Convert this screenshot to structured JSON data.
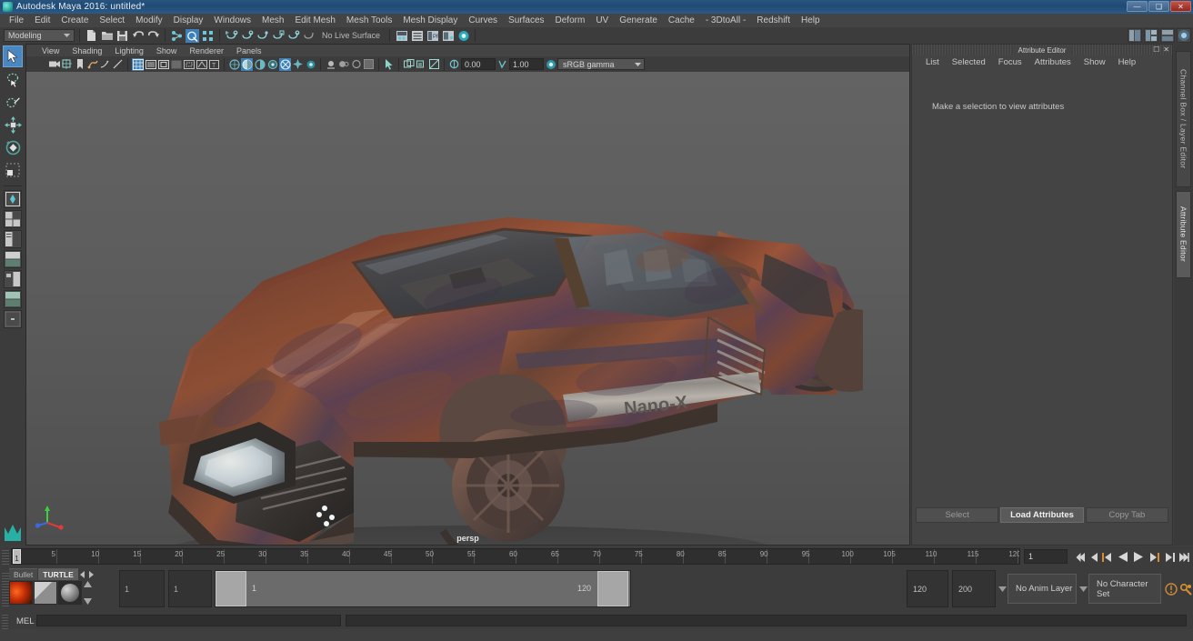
{
  "window": {
    "title": "Autodesk Maya 2016: untitled*",
    "controls": [
      "minimize",
      "restore",
      "close"
    ]
  },
  "menubar": {
    "items": [
      "File",
      "Edit",
      "Create",
      "Select",
      "Modify",
      "Display",
      "Windows",
      "Mesh",
      "Edit Mesh",
      "Mesh Tools",
      "Mesh Display",
      "Curves",
      "Surfaces",
      "Deform",
      "UV",
      "Generate",
      "Cache",
      "- 3DtoAll -",
      "Redshift",
      "Help"
    ]
  },
  "statusbar": {
    "menuset": "Modeling",
    "live_surface": "No Live Surface",
    "icons": [
      "new-scene-icon",
      "open-scene-icon",
      "save-scene-icon",
      "undo-icon",
      "redo-icon",
      "select-by-hierarchy-icon",
      "select-by-object-icon",
      "select-by-component-icon",
      "snap-to-grid-icon",
      "snap-to-curve-icon",
      "snap-to-point-icon",
      "snap-to-projected-center-icon",
      "snap-to-view-planes-icon",
      "make-live-icon",
      "show-hide-editors-icon",
      "attribute-editor-icon",
      "tool-settings-icon",
      "channel-box-icon",
      "render-view-icon"
    ]
  },
  "toolbox": {
    "tools": [
      "select-tool",
      "lasso-select-tool",
      "paint-select-tool",
      "move-tool",
      "rotate-tool",
      "scale-tool",
      "last-tool"
    ],
    "selected": "select-tool",
    "layouts": [
      "single-perspective-layout",
      "four-view-layout",
      "two-panes-side-layout",
      "outliner-persp-layout",
      "hypershade-persp-layout",
      "persp-graph-layout",
      "two-panes-stacked-layout"
    ]
  },
  "viewport": {
    "menus": [
      "View",
      "Shading",
      "Lighting",
      "Show",
      "Renderer",
      "Panels"
    ],
    "camera_label": "persp",
    "exposure": "0.00",
    "gamma": "1.00",
    "color_management": "sRGB gamma",
    "model_decal": "Nano-X",
    "icons": [
      "camera-icon",
      "two-d-pan-zoom-icon",
      "bookmark-icon",
      "image-plane-icon",
      "grid-icon",
      "film-gate-icon",
      "resolution-gate-icon",
      "gate-mask-icon",
      "film-origin-icon",
      "xray-icon",
      "xray-joints-icon",
      "xray-active-components-icon",
      "wireframe-icon",
      "smooth-shade-icon",
      "shaded-textured-icon",
      "use-all-lights-icon",
      "shadows-icon",
      "ambient-occlusion-icon",
      "motion-blur-icon",
      "multisample-icon",
      "depth-of-field-icon",
      "isolate-select-icon",
      "viewport-snapshot-icon",
      "exposure-icon",
      "gamma-icon",
      "color-management-icon"
    ]
  },
  "attribute_editor": {
    "panel_title": "Attribute Editor",
    "menus": [
      "List",
      "Selected",
      "Focus",
      "Attributes",
      "Show",
      "Help"
    ],
    "empty_message": "Make a selection to view attributes",
    "buttons": [
      "Select",
      "Load Attributes",
      "Copy Tab"
    ],
    "primary_button": "Load Attributes"
  },
  "vertical_tabs": {
    "items": [
      "Channel Box / Layer Editor",
      "Attribute Editor"
    ],
    "active": "Attribute Editor"
  },
  "time_slider": {
    "start": 1,
    "end": 120,
    "tick_labels": [
      5,
      10,
      15,
      20,
      25,
      30,
      35,
      40,
      45,
      50,
      55,
      60,
      65,
      70,
      75,
      80,
      85,
      90,
      95,
      100,
      105,
      110,
      115,
      120
    ],
    "current_frame": "1",
    "playback_controls": [
      "go-to-start-icon",
      "step-back-keyframe-icon",
      "step-back-frame-icon",
      "play-backwards-icon",
      "play-forwards-icon",
      "step-forward-frame-icon",
      "step-forward-keyframe-icon",
      "go-to-end-icon"
    ]
  },
  "range_slider": {
    "shelf_tabs": [
      "Bullet",
      "TURTLE"
    ],
    "active_shelf_tab": "TURTLE",
    "anim_start": "1",
    "range_start": "1",
    "range_bar_label": "1",
    "range_end_label": "120",
    "anim_end": "120",
    "playback_end": "200",
    "anim_layer": "No Anim Layer",
    "character_set": "No Character Set",
    "icons": [
      "auto-keyframe-icon",
      "animation-preferences-icon"
    ]
  },
  "command_line": {
    "language_label": "MEL",
    "input_value": "",
    "output_value": ""
  },
  "colors": {
    "title_blue": "#29547f",
    "panel_bg": "#444444",
    "dark_bg": "#2e2e2e",
    "accent_blue": "#3f7fb8",
    "maya_teal": "#29b0a5",
    "close_red": "#92281c"
  }
}
